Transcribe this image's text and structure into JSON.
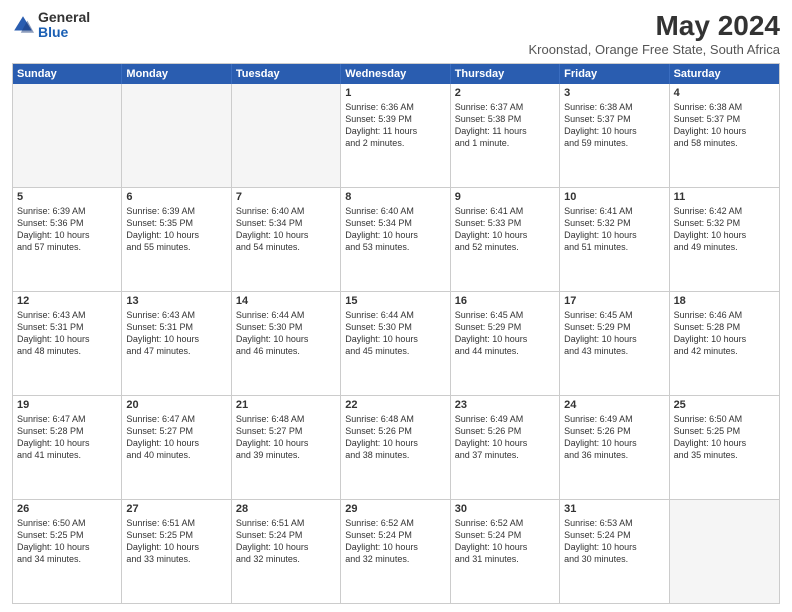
{
  "logo": {
    "general": "General",
    "blue": "Blue"
  },
  "title": "May 2024",
  "subtitle": "Kroonstad, Orange Free State, South Africa",
  "days": [
    "Sunday",
    "Monday",
    "Tuesday",
    "Wednesday",
    "Thursday",
    "Friday",
    "Saturday"
  ],
  "weeks": [
    [
      {
        "day": "",
        "info": ""
      },
      {
        "day": "",
        "info": ""
      },
      {
        "day": "",
        "info": ""
      },
      {
        "day": "1",
        "info": "Sunrise: 6:36 AM\nSunset: 5:39 PM\nDaylight: 11 hours\nand 2 minutes."
      },
      {
        "day": "2",
        "info": "Sunrise: 6:37 AM\nSunset: 5:38 PM\nDaylight: 11 hours\nand 1 minute."
      },
      {
        "day": "3",
        "info": "Sunrise: 6:38 AM\nSunset: 5:37 PM\nDaylight: 10 hours\nand 59 minutes."
      },
      {
        "day": "4",
        "info": "Sunrise: 6:38 AM\nSunset: 5:37 PM\nDaylight: 10 hours\nand 58 minutes."
      }
    ],
    [
      {
        "day": "5",
        "info": "Sunrise: 6:39 AM\nSunset: 5:36 PM\nDaylight: 10 hours\nand 57 minutes."
      },
      {
        "day": "6",
        "info": "Sunrise: 6:39 AM\nSunset: 5:35 PM\nDaylight: 10 hours\nand 55 minutes."
      },
      {
        "day": "7",
        "info": "Sunrise: 6:40 AM\nSunset: 5:34 PM\nDaylight: 10 hours\nand 54 minutes."
      },
      {
        "day": "8",
        "info": "Sunrise: 6:40 AM\nSunset: 5:34 PM\nDaylight: 10 hours\nand 53 minutes."
      },
      {
        "day": "9",
        "info": "Sunrise: 6:41 AM\nSunset: 5:33 PM\nDaylight: 10 hours\nand 52 minutes."
      },
      {
        "day": "10",
        "info": "Sunrise: 6:41 AM\nSunset: 5:32 PM\nDaylight: 10 hours\nand 51 minutes."
      },
      {
        "day": "11",
        "info": "Sunrise: 6:42 AM\nSunset: 5:32 PM\nDaylight: 10 hours\nand 49 minutes."
      }
    ],
    [
      {
        "day": "12",
        "info": "Sunrise: 6:43 AM\nSunset: 5:31 PM\nDaylight: 10 hours\nand 48 minutes."
      },
      {
        "day": "13",
        "info": "Sunrise: 6:43 AM\nSunset: 5:31 PM\nDaylight: 10 hours\nand 47 minutes."
      },
      {
        "day": "14",
        "info": "Sunrise: 6:44 AM\nSunset: 5:30 PM\nDaylight: 10 hours\nand 46 minutes."
      },
      {
        "day": "15",
        "info": "Sunrise: 6:44 AM\nSunset: 5:30 PM\nDaylight: 10 hours\nand 45 minutes."
      },
      {
        "day": "16",
        "info": "Sunrise: 6:45 AM\nSunset: 5:29 PM\nDaylight: 10 hours\nand 44 minutes."
      },
      {
        "day": "17",
        "info": "Sunrise: 6:45 AM\nSunset: 5:29 PM\nDaylight: 10 hours\nand 43 minutes."
      },
      {
        "day": "18",
        "info": "Sunrise: 6:46 AM\nSunset: 5:28 PM\nDaylight: 10 hours\nand 42 minutes."
      }
    ],
    [
      {
        "day": "19",
        "info": "Sunrise: 6:47 AM\nSunset: 5:28 PM\nDaylight: 10 hours\nand 41 minutes."
      },
      {
        "day": "20",
        "info": "Sunrise: 6:47 AM\nSunset: 5:27 PM\nDaylight: 10 hours\nand 40 minutes."
      },
      {
        "day": "21",
        "info": "Sunrise: 6:48 AM\nSunset: 5:27 PM\nDaylight: 10 hours\nand 39 minutes."
      },
      {
        "day": "22",
        "info": "Sunrise: 6:48 AM\nSunset: 5:26 PM\nDaylight: 10 hours\nand 38 minutes."
      },
      {
        "day": "23",
        "info": "Sunrise: 6:49 AM\nSunset: 5:26 PM\nDaylight: 10 hours\nand 37 minutes."
      },
      {
        "day": "24",
        "info": "Sunrise: 6:49 AM\nSunset: 5:26 PM\nDaylight: 10 hours\nand 36 minutes."
      },
      {
        "day": "25",
        "info": "Sunrise: 6:50 AM\nSunset: 5:25 PM\nDaylight: 10 hours\nand 35 minutes."
      }
    ],
    [
      {
        "day": "26",
        "info": "Sunrise: 6:50 AM\nSunset: 5:25 PM\nDaylight: 10 hours\nand 34 minutes."
      },
      {
        "day": "27",
        "info": "Sunrise: 6:51 AM\nSunset: 5:25 PM\nDaylight: 10 hours\nand 33 minutes."
      },
      {
        "day": "28",
        "info": "Sunrise: 6:51 AM\nSunset: 5:24 PM\nDaylight: 10 hours\nand 32 minutes."
      },
      {
        "day": "29",
        "info": "Sunrise: 6:52 AM\nSunset: 5:24 PM\nDaylight: 10 hours\nand 32 minutes."
      },
      {
        "day": "30",
        "info": "Sunrise: 6:52 AM\nSunset: 5:24 PM\nDaylight: 10 hours\nand 31 minutes."
      },
      {
        "day": "31",
        "info": "Sunrise: 6:53 AM\nSunset: 5:24 PM\nDaylight: 10 hours\nand 30 minutes."
      },
      {
        "day": "",
        "info": ""
      }
    ]
  ]
}
